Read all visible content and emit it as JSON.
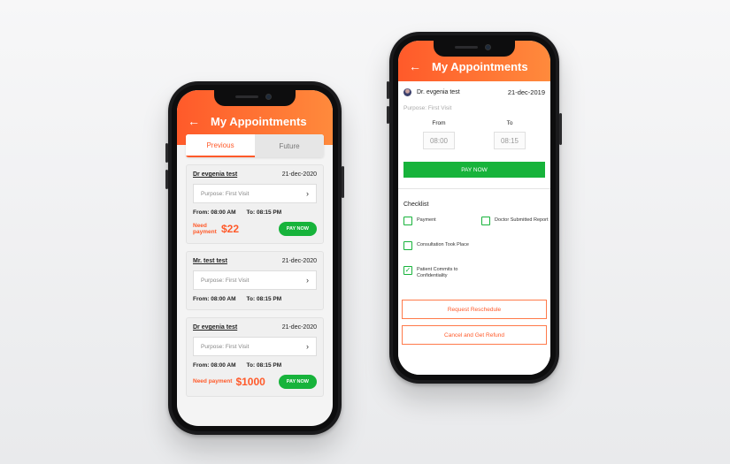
{
  "left_phone": {
    "header": {
      "back_icon": "arrow-left-icon",
      "title": "My Appointments"
    },
    "tabs": [
      {
        "label": "Previous",
        "active": true
      },
      {
        "label": "Future",
        "active": false
      }
    ],
    "appointments": [
      {
        "doctor": "Dr evgenia test",
        "date": "21-dec-2020",
        "purpose": "Purpose: First Visit",
        "from_label": "From:",
        "from": "08:00 AM",
        "to_label": "To:",
        "to": "08:15 PM",
        "need_payment_label": "Need payment",
        "amount": "$22",
        "pay_label": "PAY NOW"
      },
      {
        "doctor": "Mr. test test",
        "date": "21-dec-2020",
        "purpose": "Purpose: First Visit",
        "from_label": "From:",
        "from": "08:00 AM",
        "to_label": "To:",
        "to": "08:15 PM"
      },
      {
        "doctor": "Dr evgenia test",
        "date": "21-dec-2020",
        "purpose": "Purpose: First Visit",
        "from_label": "From:",
        "from": "08:00 AM",
        "to_label": "To:",
        "to": "08:15 PM",
        "need_payment_label": "Need payment",
        "amount": "$1000",
        "pay_label": "PAY NOW"
      }
    ]
  },
  "right_phone": {
    "header": {
      "back_icon": "arrow-left-icon",
      "title": "My Appointments"
    },
    "doctor": "Dr. evgenia test",
    "date": "21-dec-2019",
    "purpose": "Purpose: First Visit",
    "from_label": "From",
    "from": "08:00",
    "to_label": "To",
    "to": "08:15",
    "pay_label": "PAY NOW",
    "checklist_title": "Checklist",
    "checklist": [
      {
        "label": "Payment",
        "checked": false
      },
      {
        "label": "Doctor Submitted Report",
        "checked": false
      },
      {
        "label": "Consultation Took Place",
        "checked": false
      },
      {
        "label": "Patient Commits to Confidentiality",
        "checked": true
      }
    ],
    "request_reschedule": "Request Reschedule",
    "cancel_refund": "Cancel and Get Refund"
  },
  "colors": {
    "accent": "#ff5a2a",
    "accent_end": "#ff8a3c",
    "success": "#17b33b"
  }
}
